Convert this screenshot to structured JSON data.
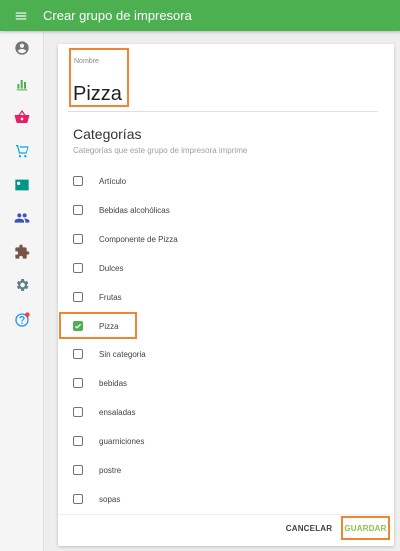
{
  "appbar": {
    "title": "Crear grupo de impresora"
  },
  "sidebar": {
    "items": [
      {
        "icon": "account-circle-icon",
        "color": "#757575"
      },
      {
        "icon": "bar-chart-icon",
        "color": "#4caf50"
      },
      {
        "icon": "basket-icon",
        "color": "#e91e63"
      },
      {
        "icon": "cart-icon",
        "color": "#03a9f4"
      },
      {
        "icon": "contact-card-icon",
        "color": "#009688"
      },
      {
        "icon": "people-icon",
        "color": "#3f51b5"
      },
      {
        "icon": "puzzle-icon",
        "color": "#795548"
      },
      {
        "icon": "gear-icon",
        "color": "#607d8b"
      },
      {
        "icon": "help-icon",
        "color": "#2196f3",
        "badge_color": "#f44336"
      }
    ]
  },
  "form": {
    "name_label": "Nombre",
    "name_value": "Pizza",
    "categories_title": "Categorías",
    "categories_subtitle": "Categorías que este grupo de impresora imprime",
    "categories": [
      {
        "label": "Artículo",
        "checked": false
      },
      {
        "label": "Bebidas alcohólicas",
        "checked": false
      },
      {
        "label": "Componente de Pizza",
        "checked": false
      },
      {
        "label": "Dulces",
        "checked": false
      },
      {
        "label": "Frutas",
        "checked": false
      },
      {
        "label": "Pizza",
        "checked": true
      },
      {
        "label": "Sin categoria",
        "checked": false
      },
      {
        "label": "bebidas",
        "checked": false
      },
      {
        "label": "ensaladas",
        "checked": false
      },
      {
        "label": "guarniciones",
        "checked": false
      },
      {
        "label": "postre",
        "checked": false
      },
      {
        "label": "sopas",
        "checked": false
      }
    ]
  },
  "actions": {
    "cancel_label": "CANCELAR",
    "save_label": "GUARDAR"
  },
  "colors": {
    "primary": "#4caf50",
    "highlight": "#ef8533",
    "save_text": "#8bc34a"
  }
}
